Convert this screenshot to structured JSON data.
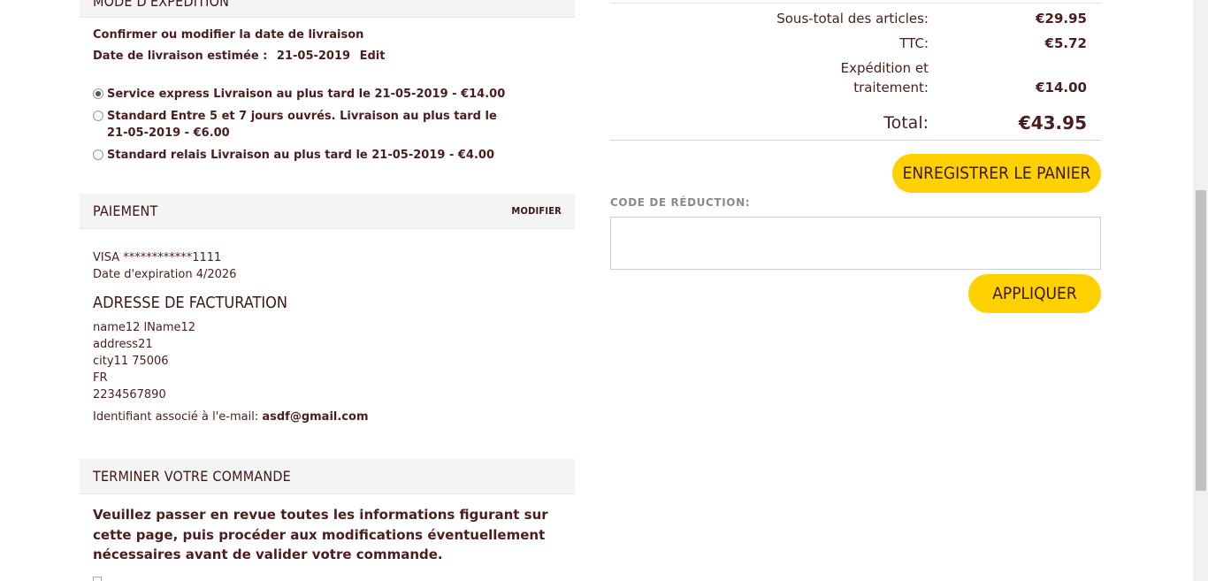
{
  "shipping": {
    "header_title": "MODE D'EXPÉDITION",
    "confirm_label": "Confirmer ou modifier la date de livraison",
    "estimated_label": "Date de livraison estimée :",
    "estimated_date": "21-05-2019",
    "edit_label": "Edit",
    "options": [
      {
        "label": "Service express Livraison au plus tard le 21-05-2019 - €14.00",
        "checked": true
      },
      {
        "label": "Standard Entre 5 et 7 jours ouvrés. Livraison au plus tard le 21-05-2019 - €6.00",
        "checked": false
      },
      {
        "label": "Standard relais Livraison au plus tard le 21-05-2019 - €4.00",
        "checked": false
      }
    ]
  },
  "payment": {
    "header_title": "PAIEMENT",
    "modify_label": "MODIFIER",
    "card": "VISA ************1111",
    "expiration": "Date d'expiration 4/2026"
  },
  "billing": {
    "title": "ADRESSE DE FACTURATION",
    "name": "name12 lName12",
    "address": "address21",
    "city": "city11 75006",
    "country": "FR",
    "phone": "2234567890",
    "email_label": "Identifiant associé à l'e-mail:",
    "email": "asdf@gmail.com"
  },
  "finish": {
    "header_title": "TERMINER VOTRE COMMANDE",
    "review_text": "Veuillez passer en revue toutes les informations figurant sur cette page, puis procéder aux modifications éventuellement nécessaires avant de valider votre commande."
  },
  "summary": {
    "subtotal_label": "Sous-total des articles:",
    "subtotal_value": "€29.95",
    "tax_label": "TTC:",
    "tax_value": "€5.72",
    "shipping_label_1": "Expédition et",
    "shipping_label_2": "traitement:",
    "shipping_value": "€14.00",
    "total_label": "Total:",
    "total_value": "€43.95"
  },
  "cart": {
    "save_label": "ENREGISTRER LE PANIER",
    "promo_label": "CODE DE RÉDUCTION:",
    "promo_value": "",
    "apply_label": "APPLIQUER"
  },
  "colors": {
    "accent_yellow": "#ffd100",
    "text_brown": "#4a1e1e",
    "header_bg": "#f4f4f4"
  }
}
